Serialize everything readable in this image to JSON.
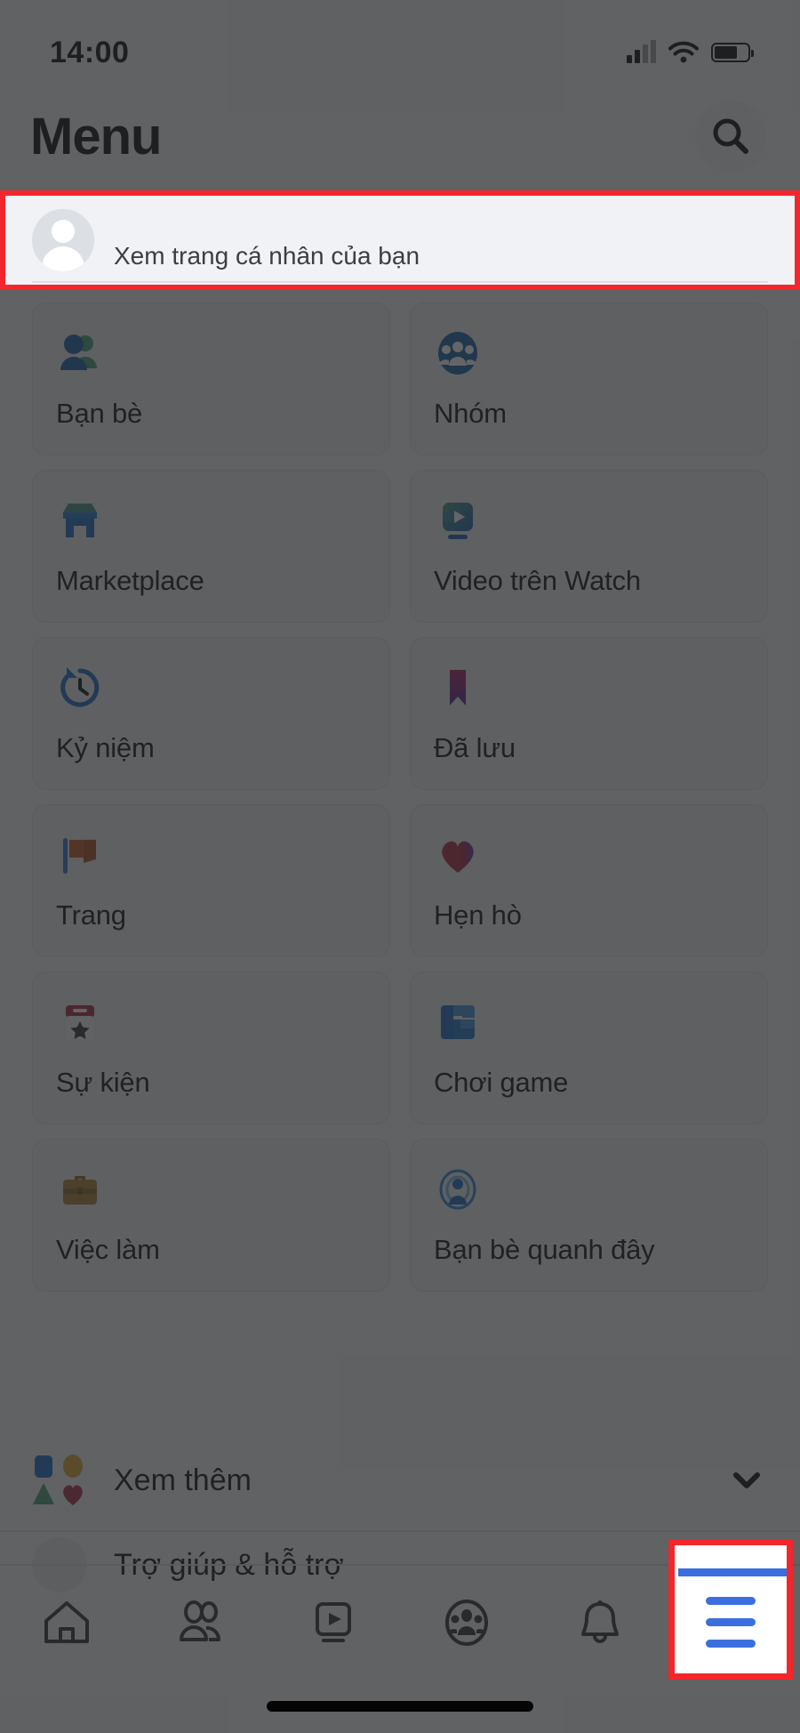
{
  "status_bar": {
    "time": "14:00",
    "signal_icon": "cellular-signal-icon",
    "wifi_icon": "wifi-icon",
    "battery_icon": "battery-icon"
  },
  "header": {
    "title": "Menu",
    "search_icon": "search-icon"
  },
  "profile": {
    "name": "",
    "subtitle": "Xem trang cá nhân của bạn",
    "avatar_icon": "avatar-placeholder-icon",
    "highlight_color": "#f5252c"
  },
  "menu_grid": [
    {
      "label": "Bạn bè",
      "icon": "friends-icon"
    },
    {
      "label": "Nhóm",
      "icon": "groups-icon"
    },
    {
      "label": "Marketplace",
      "icon": "marketplace-icon"
    },
    {
      "label": "Video trên Watch",
      "icon": "watch-video-icon"
    },
    {
      "label": "Kỷ niệm",
      "icon": "memories-clock-icon"
    },
    {
      "label": "Đã lưu",
      "icon": "saved-bookmark-icon"
    },
    {
      "label": "Trang",
      "icon": "pages-flag-icon"
    },
    {
      "label": "Hẹn hò",
      "icon": "dating-heart-icon"
    },
    {
      "label": "Sự kiện",
      "icon": "events-calendar-icon"
    },
    {
      "label": "Chơi game",
      "icon": "gaming-icon"
    },
    {
      "label": "Việc làm",
      "icon": "jobs-briefcase-icon"
    },
    {
      "label": "Bạn bè quanh đây",
      "icon": "nearby-friends-icon"
    }
  ],
  "see_more": {
    "label": "Xem thêm",
    "icon": "shapes-icon",
    "chevron_icon": "chevron-down-icon"
  },
  "partial_row": {
    "label": "Trợ giúp & hỗ trợ",
    "icon": "help-support-icon"
  },
  "tab_bar": {
    "tabs": [
      {
        "name": "home",
        "icon": "home-icon",
        "active": false
      },
      {
        "name": "friends",
        "icon": "friends-outline-icon",
        "active": false
      },
      {
        "name": "watch",
        "icon": "video-play-icon",
        "active": false
      },
      {
        "name": "groups",
        "icon": "groups-outline-icon",
        "active": false
      },
      {
        "name": "notifications",
        "icon": "bell-icon",
        "active": false
      },
      {
        "name": "menu",
        "icon": "hamburger-menu-icon",
        "active": true
      }
    ],
    "active_color": "#3b6fe0",
    "highlight_color": "#f5252c"
  },
  "theme": {
    "dim_overlay": "rgba(40,41,43,0.72)",
    "page_background": "#f0f2f5",
    "tile_background": "#e9ebee",
    "text_primary": "#0b0c0d"
  }
}
